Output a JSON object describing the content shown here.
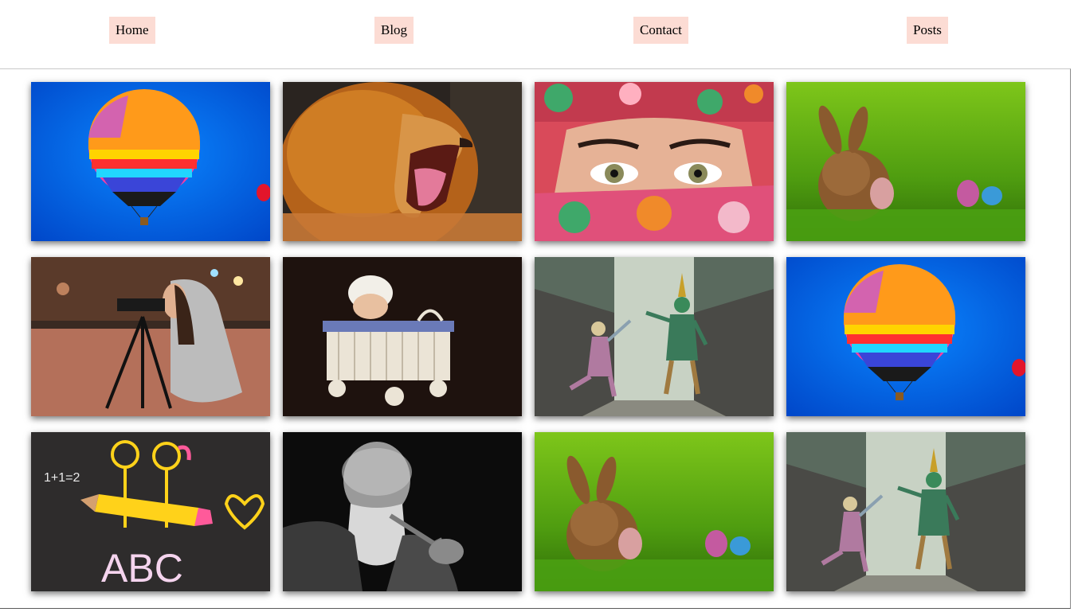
{
  "nav": {
    "items": [
      {
        "label": "Home"
      },
      {
        "label": "Blog"
      },
      {
        "label": "Contact"
      },
      {
        "label": "Posts"
      }
    ]
  },
  "gallery": {
    "images": [
      {
        "subject": "hot-air-balloon"
      },
      {
        "subject": "roaring-lion"
      },
      {
        "subject": "woman-eyes-headscarf"
      },
      {
        "subject": "bunny-easter-eggs"
      },
      {
        "subject": "girl-with-camera-tripod"
      },
      {
        "subject": "baby-in-basket-cart"
      },
      {
        "subject": "thai-dancers-masks"
      },
      {
        "subject": "hot-air-balloon"
      },
      {
        "subject": "chalkboard-drawing"
      },
      {
        "subject": "old-man-pipe"
      },
      {
        "subject": "bunny-easter-eggs"
      },
      {
        "subject": "thai-dancers-masks"
      }
    ],
    "chalkboard": {
      "equation": "1+1=2",
      "letters": "ABC"
    }
  }
}
